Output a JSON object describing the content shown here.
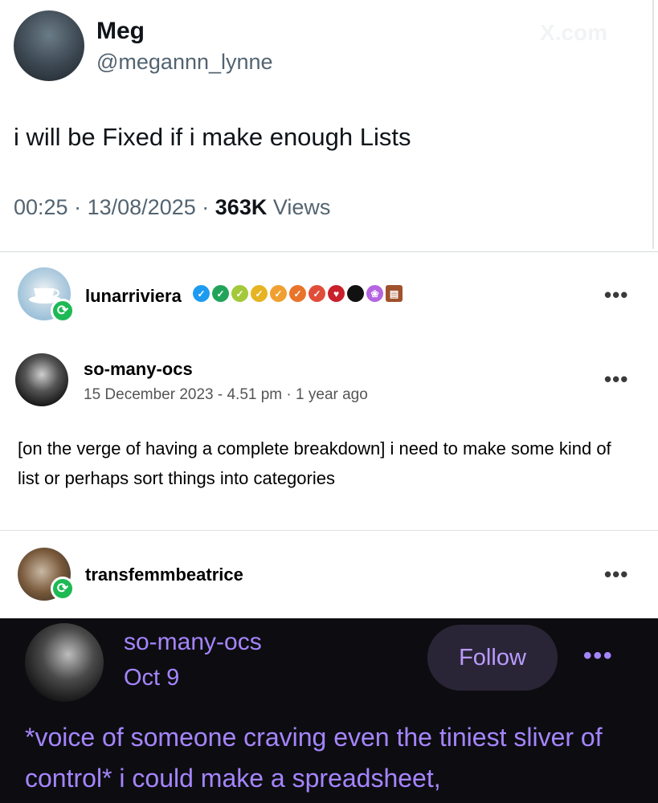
{
  "tweet": {
    "author_name": "Meg",
    "author_handle": "@megannn_lynne",
    "watermark": "X.com",
    "text": "i will be Fixed if i make enough Lists",
    "time": "00:25",
    "date": "13/08/2025",
    "separator": "·",
    "views_count": "363K",
    "views_label": "Views"
  },
  "tumblr": {
    "reblogger1": {
      "username": "lunarriviera",
      "badge_colors": [
        "#1d9bf0",
        "#22a35a",
        "#a3c93a",
        "#e6b422",
        "#f0a030",
        "#e8742a",
        "#e04e39",
        "#c9202c",
        "#111111",
        "#b565e0",
        "#a0522d"
      ]
    },
    "original_post": {
      "username": "so-many-ocs",
      "date": "15 December 2023 - 4.51 pm",
      "separator": "·",
      "age": "1 year ago",
      "body": "[on the verge of having a complete breakdown] i need to make some kind of list or perhaps sort things into categories"
    },
    "reblogger2": {
      "username": "transfemmbeatrice"
    },
    "more_label": "•••"
  },
  "dark_post": {
    "username": "so-many-ocs",
    "date": "Oct 9",
    "follow_label": "Follow",
    "more_label": "•••",
    "body": "*voice of someone craving even the tiniest sliver of control* i could make a spreadsheet,",
    "accent_color": "#a585ff"
  }
}
